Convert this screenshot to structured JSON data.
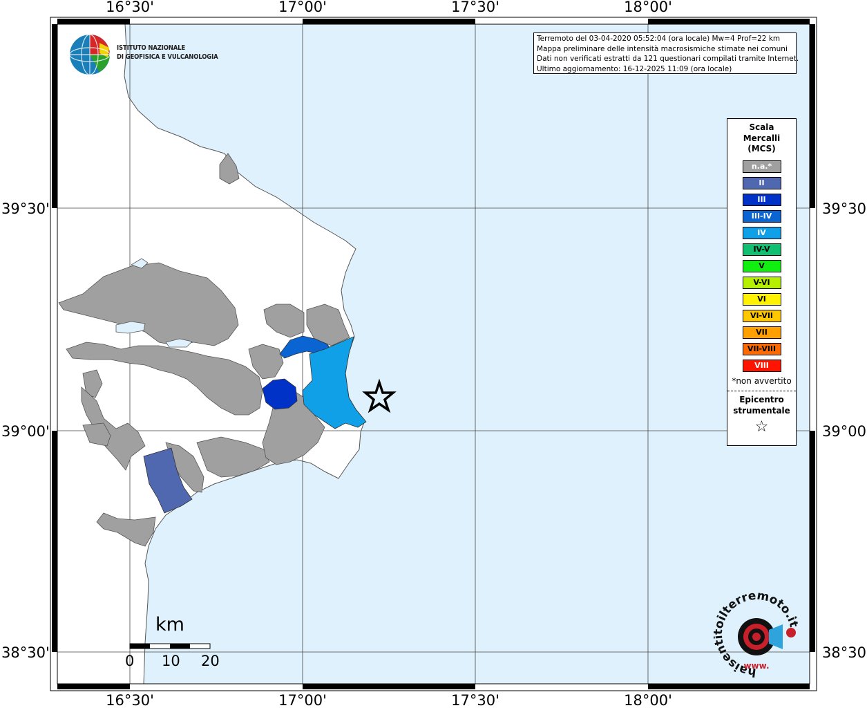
{
  "info": {
    "line1": "Terremoto del 03-04-2020 05:52:04 (ora locale) Mw=4 Prof=22 km",
    "line2": "Mappa preliminare delle intensità macrosismiche stimate nei comuni",
    "line3": "Dati non verificati estratti da 121 questionari compilati tramite Internet.",
    "line4": "Ultimo aggiornamento: 16-12-2025 11:09 (ora locale)"
  },
  "axes": {
    "x_ticks": [
      "16°30'",
      "17°00'",
      "17°30'",
      "18°00'"
    ],
    "y_ticks": [
      "39°30'",
      "39°00'",
      "38°30'"
    ]
  },
  "logo": {
    "org_line1": "ISTITUTO NAZIONALE",
    "org_line2": "DI GEOFISICA E VULCANOLOGIA"
  },
  "legend": {
    "title_line1": "Scala",
    "title_line2": "Mercalli",
    "title_line3": "(MCS)",
    "items": [
      {
        "label": "n.a.*",
        "color": "#a0a0a0",
        "text_color": "#ffffff"
      },
      {
        "label": "II",
        "color": "#5068b0",
        "text_color": "#ffffff"
      },
      {
        "label": "III",
        "color": "#0032c8",
        "text_color": "#ffffff"
      },
      {
        "label": "III-IV",
        "color": "#0a64d2",
        "text_color": "#ffffff"
      },
      {
        "label": "IV",
        "color": "#10a0e8",
        "text_color": "#ffffff"
      },
      {
        "label": "IV-V",
        "color": "#10c070",
        "text_color": "#000000"
      },
      {
        "label": "V",
        "color": "#10ef10",
        "text_color": "#000000"
      },
      {
        "label": "V-VI",
        "color": "#b4f000",
        "text_color": "#000000"
      },
      {
        "label": "VI",
        "color": "#fff200",
        "text_color": "#000000"
      },
      {
        "label": "VI-VII",
        "color": "#ffc800",
        "text_color": "#000000"
      },
      {
        "label": "VII",
        "color": "#ffa000",
        "text_color": "#000000"
      },
      {
        "label": "VII-VIII",
        "color": "#ff6a00",
        "text_color": "#000000"
      },
      {
        "label": "VIII",
        "color": "#ff1400",
        "text_color": "#ffffff"
      }
    ],
    "note": "*non avvertito",
    "epi_line1": "Epicentro",
    "epi_line2": "strumentale",
    "epi_symbol": "☆"
  },
  "scale": {
    "unit": "km",
    "labels": [
      "0",
      "10",
      "20"
    ]
  },
  "hsit": {
    "text": "haisentitoilterremoto.it",
    "www": "www."
  },
  "colors": {
    "sea": "#dff1fc",
    "land": "#ffffff",
    "not_assessed": "#a0a0a0",
    "intensity_II": "#5068b0",
    "intensity_III": "#0032c8",
    "intensity_III_IV": "#0a64d2",
    "intensity_IV": "#10a0e8"
  }
}
